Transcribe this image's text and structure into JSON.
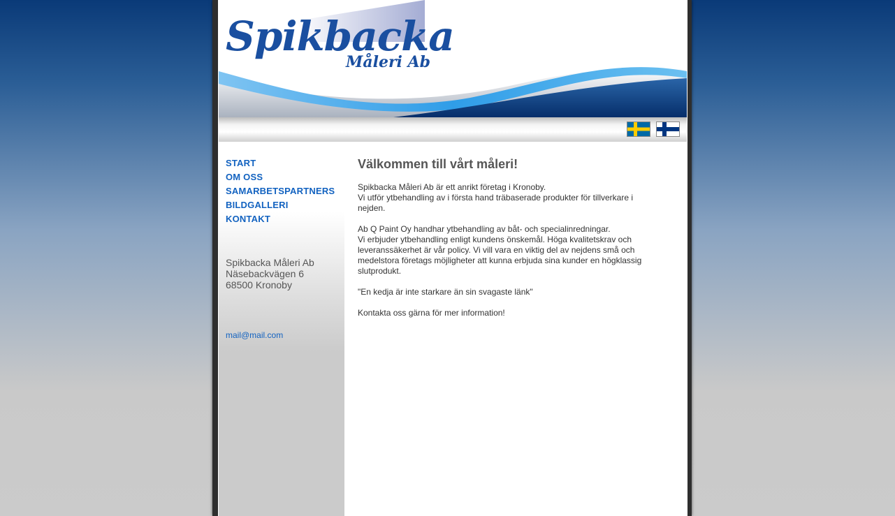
{
  "header": {
    "logo_title": "Spikbacka",
    "logo_subtitle": "Måleri Ab"
  },
  "languages": [
    {
      "name": "swedish-flag",
      "colors": [
        "#006aa7",
        "#fecc00"
      ]
    },
    {
      "name": "finnish-flag",
      "colors": [
        "#ffffff",
        "#003580"
      ]
    }
  ],
  "nav": {
    "items": [
      "START",
      "OM OSS",
      "SAMARBETSPARTNERS",
      "BILDGALLERI",
      "KONTAKT"
    ]
  },
  "sidebar": {
    "address_lines": [
      "Spikbacka Måleri Ab",
      "Näsebackvägen 6",
      "68500 Kronoby"
    ],
    "email": "mail@mail.com"
  },
  "main": {
    "title": "Välkommen till vårt måleri!",
    "paragraphs": [
      [
        "Spikbacka Måleri Ab är ett anrikt företag i Kronoby.",
        "Vi utför ytbehandling av i första hand träbaserade produkter för tillverkare i nejden."
      ],
      [
        "Ab Q Paint Oy handhar ytbehandling av båt- och specialinredningar.",
        "Vi erbjuder ytbehandling enligt kundens önskemål. Höga kvalitetskrav och leveranssäkerhet är vår policy. Vi vill vara en viktig del av nejdens små och medelstora företags möjligheter att kunna erbjuda sina kunder en högklassig slutprodukt."
      ],
      [
        "\"En kedja är inte starkare än sin svagaste länk\""
      ],
      [
        "Kontakta oss gärna för mer information!"
      ]
    ]
  },
  "colors": {
    "brand_blue": "#1a4fa0",
    "link_blue": "#1262c0",
    "wave_light": "#3aa6ec",
    "wave_dark": "#0a3a78"
  }
}
